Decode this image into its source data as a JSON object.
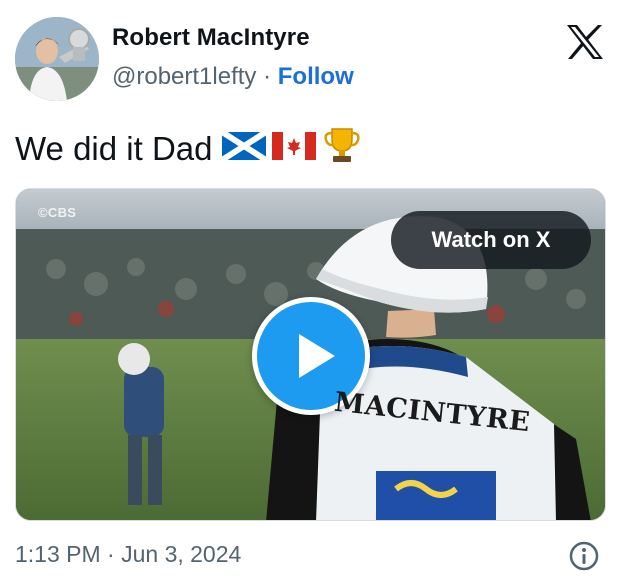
{
  "author": {
    "name": "Robert MacIntyre",
    "handle": "@robert1lefty",
    "separator": "·",
    "follow_label": "Follow",
    "avatar": "avatar-photo"
  },
  "header": {
    "logo_icon": "x-logo-icon"
  },
  "tweet": {
    "text": "We did it Dad",
    "emojis": [
      "scotland-flag-icon",
      "canada-flag-icon",
      "trophy-icon"
    ]
  },
  "video": {
    "watermark": "©CBS",
    "watch_label": "Watch on X",
    "play_icon": "play-icon",
    "bib_text": "MACINTYRE"
  },
  "footer": {
    "timestamp": "1:13 PM · Jun 3, 2024",
    "info_icon": "info-icon"
  },
  "colors": {
    "follow": "#1d6fd8",
    "play_button": "#1d9bf0",
    "secondary_text": "#536471"
  }
}
